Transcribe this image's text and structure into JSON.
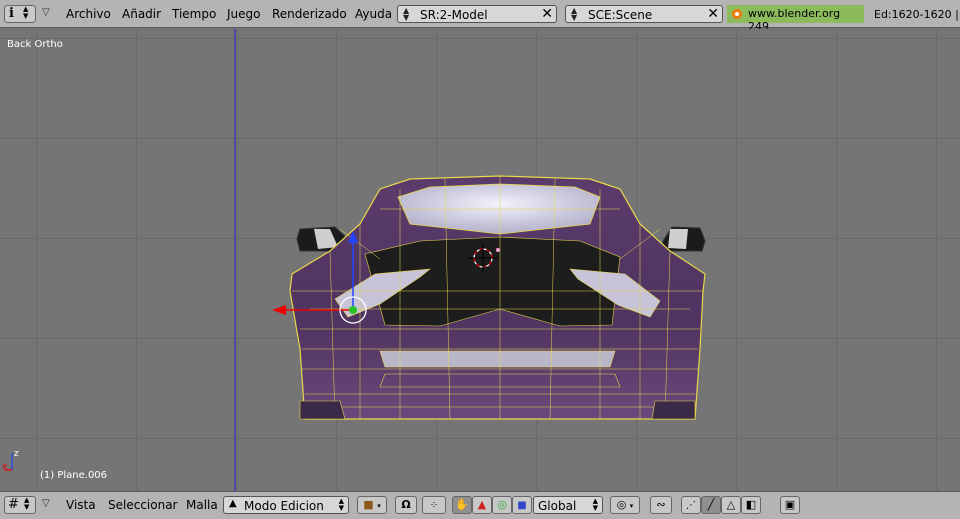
{
  "header": {
    "menus": [
      "Archivo",
      "Añadir",
      "Tiempo",
      "Juego",
      "Renderizado",
      "Ayuda"
    ],
    "screen_field": "SR:2-Model",
    "scene_field": "SCE:Scene",
    "site_text": "www.blender.org 249",
    "stats_text": "Ed:1620-1620 |"
  },
  "viewport": {
    "view_label": "Back Ortho",
    "object_label": "(1) Plane.006",
    "axis_z": "z",
    "axis_x": "x"
  },
  "footer": {
    "menus": [
      "Vista",
      "Seleccionar",
      "Malla"
    ],
    "mode_select": "Modo Edicion",
    "orientation_select": "Global"
  },
  "colors": {
    "panel": "#b4b4b4",
    "grid_bg": "#757575",
    "wire": "#e8d84a",
    "body": "#5a3d6a",
    "site_badge": "#8cbb5c"
  },
  "icons": [
    "info-icon",
    "menu-arrow-icon",
    "close-icon",
    "blender-logo-icon",
    "grid-icon",
    "object-icon",
    "magnet-icon",
    "hand-icon",
    "triangle-icon",
    "circle-icon",
    "square-icon",
    "pivot-icon",
    "link-icon",
    "vertex-select-icon",
    "edge-select-icon",
    "face-select-icon",
    "occlude-icon",
    "render-icon"
  ]
}
